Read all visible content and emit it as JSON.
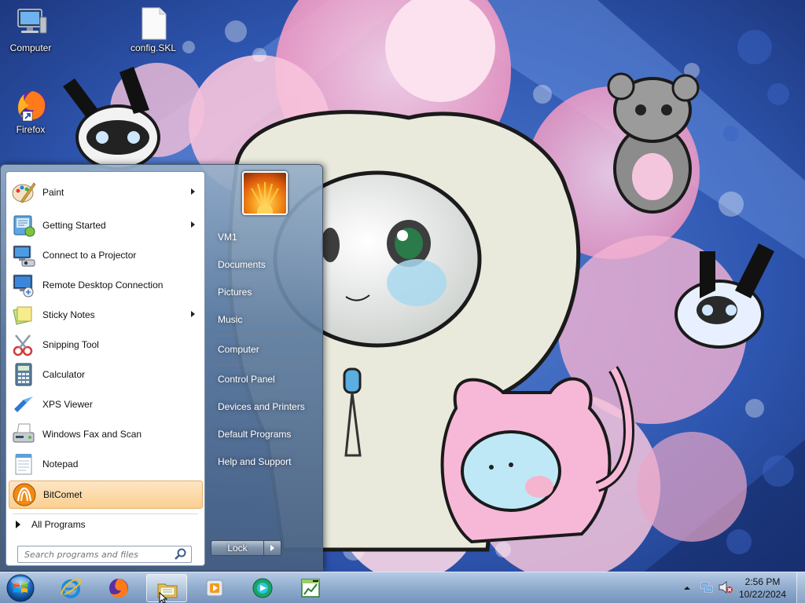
{
  "desktop": {
    "icons": [
      {
        "label": "Computer",
        "icon": "computer-icon"
      },
      {
        "label": "config.SKL",
        "icon": "file-icon"
      },
      {
        "label": "Firefox",
        "icon": "firefox-icon"
      }
    ]
  },
  "start_menu": {
    "programs": [
      {
        "label": "Paint",
        "icon": "paint-icon",
        "submenu": true
      },
      {
        "label": "Getting Started",
        "icon": "getting-started-icon",
        "submenu": true
      },
      {
        "label": "Connect to a Projector",
        "icon": "projector-icon",
        "submenu": false
      },
      {
        "label": "Remote Desktop Connection",
        "icon": "remote-desktop-icon",
        "submenu": false
      },
      {
        "label": "Sticky Notes",
        "icon": "sticky-notes-icon",
        "submenu": true
      },
      {
        "label": "Snipping Tool",
        "icon": "snipping-tool-icon",
        "submenu": false
      },
      {
        "label": "Calculator",
        "icon": "calculator-icon",
        "submenu": false
      },
      {
        "label": "XPS Viewer",
        "icon": "xps-viewer-icon",
        "submenu": false
      },
      {
        "label": "Windows Fax and Scan",
        "icon": "fax-scan-icon",
        "submenu": false
      },
      {
        "label": "Notepad",
        "icon": "notepad-icon",
        "submenu": false
      },
      {
        "label": "BitComet",
        "icon": "bitcomet-icon",
        "submenu": false,
        "highlighted": true
      }
    ],
    "all_programs": "All Programs",
    "search_placeholder": "Search programs and files",
    "right_items": [
      {
        "label": "VM1"
      },
      {
        "label": "Documents"
      },
      {
        "label": "Pictures"
      },
      {
        "label": "Music"
      },
      {
        "label": "Computer"
      },
      {
        "label": "Control Panel"
      },
      {
        "label": "Devices and Printers"
      },
      {
        "label": "Default Programs"
      },
      {
        "label": "Help and Support"
      }
    ],
    "lock_label": "Lock"
  },
  "taskbar": {
    "pinned": [
      {
        "icon": "internet-explorer-icon"
      },
      {
        "icon": "firefox-icon"
      },
      {
        "icon": "windows-explorer-icon",
        "active": true
      },
      {
        "icon": "media-player-icon"
      },
      {
        "icon": "media-center-icon"
      },
      {
        "icon": "bitcomet-chart-icon"
      }
    ],
    "clock": {
      "time": "2:56 PM",
      "date": "10/22/2024"
    }
  }
}
